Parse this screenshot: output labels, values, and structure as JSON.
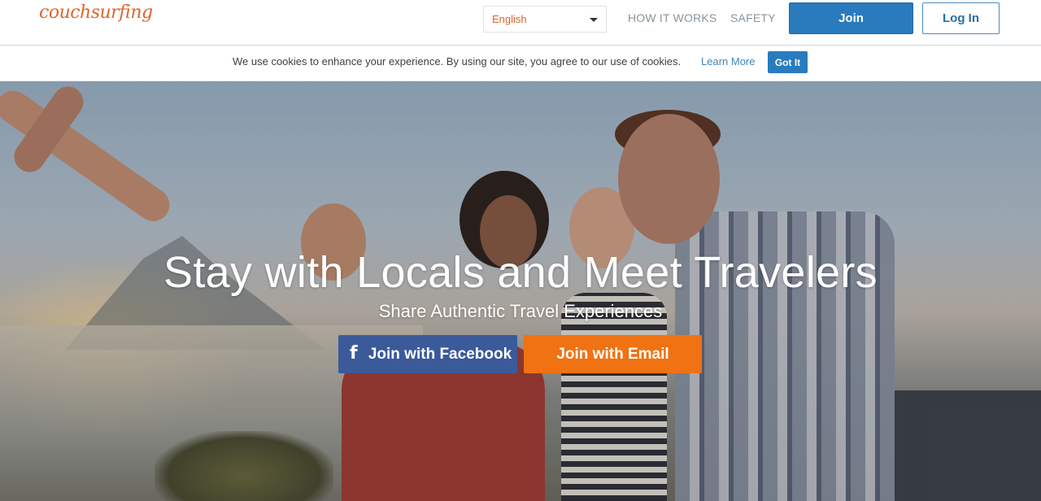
{
  "header": {
    "logo": "couchsurfing",
    "language": "English",
    "nav": [
      "HOW IT WORKS",
      "SAFETY"
    ],
    "join_label": "Join",
    "login_label": "Log In"
  },
  "cookie_bar": {
    "text": "We use cookies to enhance your experience. By using our site, you agree to our use of cookies.",
    "learn_more": "Learn More",
    "got_it": "Got It"
  },
  "hero": {
    "title": "Stay with Locals and Meet Travelers",
    "subtitle": "Share Authentic Travel Experiences",
    "facebook_icon": "f",
    "facebook_button": "Join with Facebook",
    "email_button": "Join with Email"
  },
  "colors": {
    "brand_orange": "#e0642a",
    "primary_blue": "#2a7bbd",
    "facebook_blue": "#3b5a9a",
    "email_orange": "#f07212"
  }
}
